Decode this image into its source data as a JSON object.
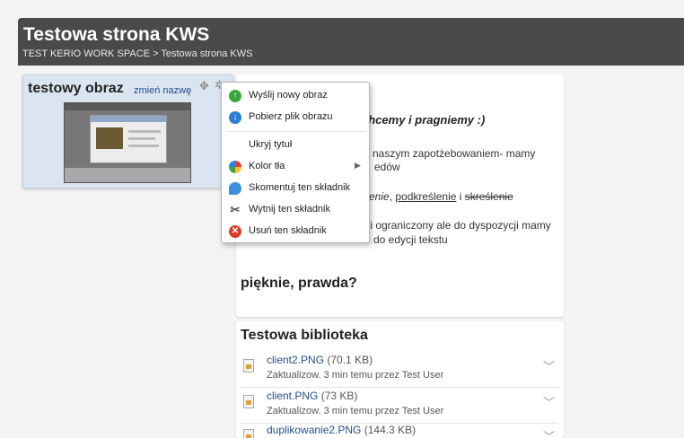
{
  "header": {
    "title": "Testowa strona KWS",
    "breadcrumb_root": "TEST KERIO WORK SPACE",
    "breadcrumb_sep": ">",
    "breadcrumb_current": "Testowa strona KWS"
  },
  "widget": {
    "title": "testowy obraz",
    "rename_link": "zmień nazwę",
    "move_icon": "move-icon",
    "settings_icon": "gear-icon"
  },
  "menu": {
    "items": [
      {
        "label": "Wyślij nowy obraz",
        "icon": "upload-icon",
        "color": "#3aa53a"
      },
      {
        "label": "Pobierz plik obrazu",
        "icon": "download-icon",
        "color": "#2b7fd4"
      },
      {
        "label": "Ukryj tytuł"
      },
      {
        "label": "Kolor tła",
        "icon": "color-wheel-icon"
      },
      {
        "label": "Skomentuj ten składnik",
        "icon": "comment-icon",
        "color": "#3b8fe0"
      },
      {
        "label": "Wytnij ten składnik",
        "icon": "scissors-icon"
      },
      {
        "label": "Usuń ten składnik",
        "icon": "delete-icon",
        "color": "#d93a2b"
      }
    ]
  },
  "text_panel": {
    "heading": "chcemy i pragniemy :)",
    "p1_line1": "i i naszym zapotżebowaniem- mamy",
    "p1_line2": "edów",
    "p2_italic": "enie",
    "p2_comma": ", ",
    "p2_underline": "podkreślenie",
    "p2_and": " i ",
    "p2_strike": "skreślenie",
    "p3_line1": "y i ograniczony ale do dyspozycji mamy",
    "p3_line2": "do edycji tekstu",
    "bottom": "pięknie, prawda?"
  },
  "library": {
    "title": "Testowa biblioteka",
    "files": [
      {
        "name": "client2.PNG",
        "size": "(70.1 KB)",
        "meta": "Zaktualizow. 3 min temu przez Test User"
      },
      {
        "name": "client.PNG",
        "size": "(73 KB)",
        "meta": "Zaktualizow. 3 min temu przez Test User"
      },
      {
        "name": "duplikowanie2.PNG",
        "size": "(144.3 KB)",
        "meta": ""
      }
    ]
  }
}
